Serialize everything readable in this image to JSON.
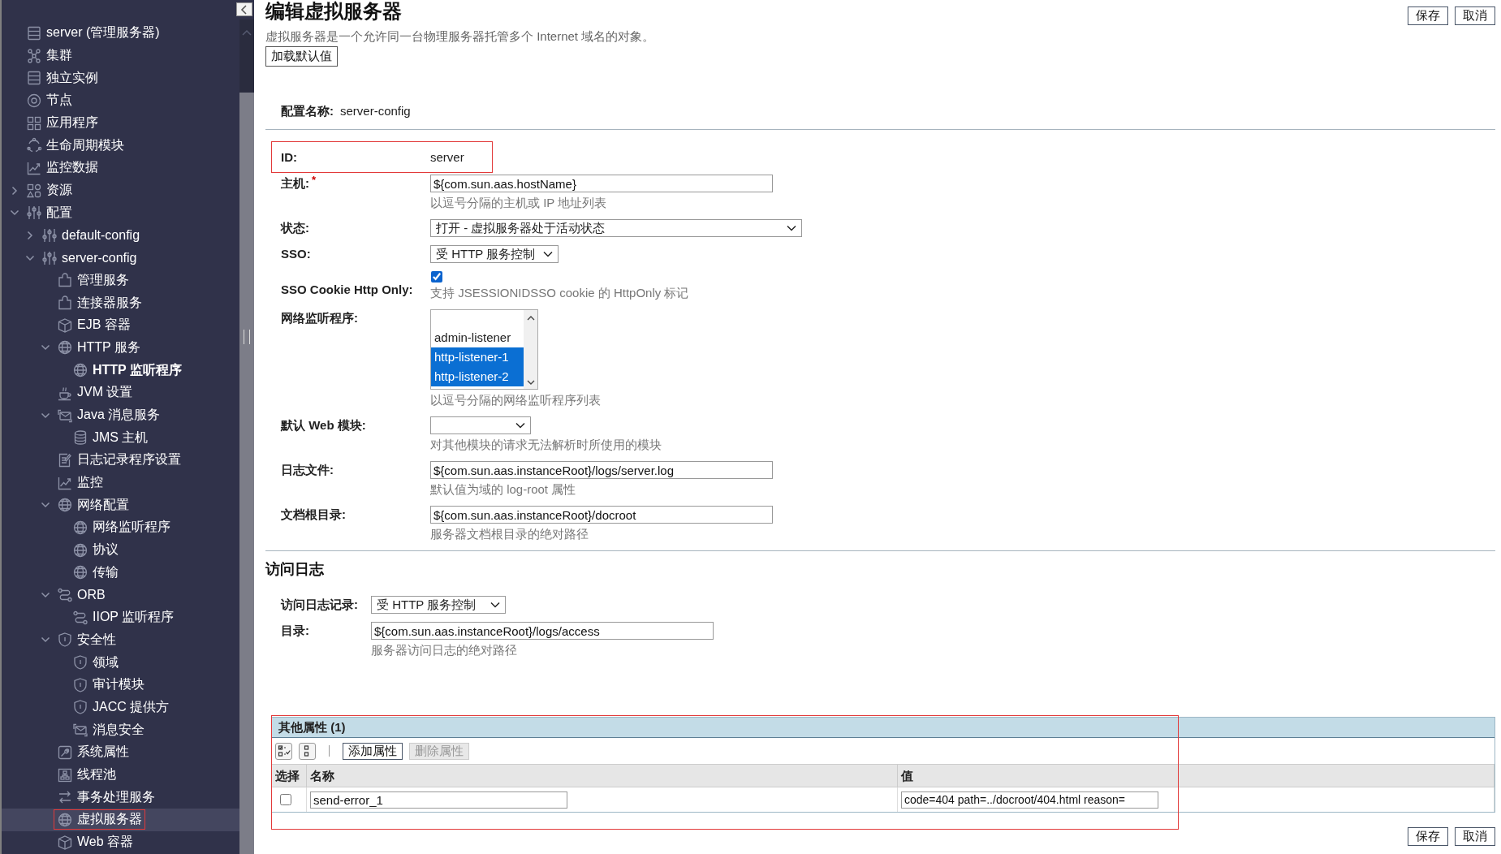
{
  "sidebar": {
    "items": [
      {
        "label": "server (管理服务器)",
        "kind": "server"
      },
      {
        "label": "集群",
        "kind": "cluster"
      },
      {
        "label": "独立实例",
        "kind": "server"
      },
      {
        "label": "节点",
        "kind": "node"
      },
      {
        "label": "应用程序",
        "kind": "apps"
      },
      {
        "label": "生命周期模块",
        "kind": "cycle"
      },
      {
        "label": "监控数据",
        "kind": "chart"
      },
      {
        "label": "资源",
        "kind": "shapes",
        "expanded": false
      },
      {
        "label": "配置",
        "kind": "sliders",
        "expanded": true,
        "children": [
          {
            "label": "default-config",
            "kind": "sliders",
            "expanded": false
          },
          {
            "label": "server-config",
            "kind": "sliders",
            "expanded": true,
            "children": [
              {
                "label": "管理服务",
                "kind": "puzzle"
              },
              {
                "label": "连接器服务",
                "kind": "puzzle"
              },
              {
                "label": "EJB 容器",
                "kind": "cube"
              },
              {
                "label": "HTTP 服务",
                "kind": "globe",
                "expanded": true,
                "children": [
                  {
                    "label": "HTTP 监听程序",
                    "kind": "globe",
                    "bold": true
                  }
                ]
              },
              {
                "label": "JVM 设置",
                "kind": "cup"
              },
              {
                "label": "Java 消息服务",
                "kind": "mail",
                "expanded": true,
                "children": [
                  {
                    "label": "JMS 主机",
                    "kind": "db"
                  }
                ]
              },
              {
                "label": "日志记录程序设置",
                "kind": "doc"
              },
              {
                "label": "监控",
                "kind": "chart"
              },
              {
                "label": "网络配置",
                "kind": "globe",
                "expanded": true,
                "children": [
                  {
                    "label": "网络监听程序",
                    "kind": "globe"
                  },
                  {
                    "label": "协议",
                    "kind": "globe"
                  },
                  {
                    "label": "传输",
                    "kind": "globe"
                  }
                ]
              },
              {
                "label": "ORB",
                "kind": "route",
                "expanded": true,
                "children": [
                  {
                    "label": "IIOP 监听程序",
                    "kind": "route"
                  }
                ]
              },
              {
                "label": "安全性",
                "kind": "shield",
                "expanded": true,
                "children": [
                  {
                    "label": "领域",
                    "kind": "shield"
                  },
                  {
                    "label": "审计模块",
                    "kind": "shield"
                  },
                  {
                    "label": "JACC 提供方",
                    "kind": "shield"
                  },
                  {
                    "label": "消息安全",
                    "kind": "mail"
                  }
                ]
              },
              {
                "label": "系统属性",
                "kind": "wrench"
              },
              {
                "label": "线程池",
                "kind": "pool"
              },
              {
                "label": "事务处理服务",
                "kind": "arrows"
              },
              {
                "label": "虚拟服务器",
                "kind": "globe",
                "selected": true,
                "highlighted": true
              },
              {
                "label": "Web 容器",
                "kind": "cube"
              }
            ]
          }
        ]
      }
    ]
  },
  "page": {
    "title": "编辑虚拟服务器",
    "description": "虚拟服务器是一个允许同一台物理服务器托管多个 Internet 域名的对象。",
    "load_defaults_button": "加载默认值",
    "top_buttons": [
      "保存",
      "取消"
    ],
    "config_name": {
      "label": "配置名称:",
      "value": "server-config"
    }
  },
  "form": {
    "fields": [
      {
        "kind": "text",
        "label": "ID:",
        "value": "server",
        "highlighted": true
      },
      {
        "kind": "input",
        "label": "主机:",
        "required_mark": "*",
        "value": "${com.sun.aas.hostName}",
        "help": "以逗号分隔的主机或 IP 地址列表"
      },
      {
        "kind": "select",
        "label": "状态:",
        "value": "打开 - 虚拟服务器处于活动状态"
      },
      {
        "kind": "select",
        "label": "SSO:",
        "value": "受 HTTP 服务控制"
      },
      {
        "kind": "checkbox",
        "label": "SSO Cookie Http Only:",
        "checked": true,
        "help": "支持 JSESSIONIDSSO cookie 的 HttpOnly 标记"
      },
      {
        "kind": "listbox",
        "label": "网络监听程序:",
        "options": [
          {
            "label": "admin-listener",
            "selected": false
          },
          {
            "label": "http-listener-1",
            "selected": true
          },
          {
            "label": "http-listener-2",
            "selected": true
          }
        ],
        "help": "以逗号分隔的网络监听程序列表"
      },
      {
        "kind": "select",
        "label": "默认 Web 模块:",
        "help": "对其他模块的请求无法解析时所使用的模块"
      },
      {
        "kind": "input",
        "label": "日志文件:",
        "value": "${com.sun.aas.instanceRoot}/logs/server.log",
        "help": "默认值为域的 log-root 属性"
      },
      {
        "kind": "input",
        "label": "文档根目录:",
        "value": "${com.sun.aas.instanceRoot}/docroot",
        "help": "服务器文档根目录的绝对路径"
      }
    ]
  },
  "access_log": {
    "title": "访问日志",
    "fields": [
      {
        "kind": "select",
        "label": "访问日志记录:",
        "value": "受 HTTP 服务控制"
      },
      {
        "kind": "input",
        "label": "目录:",
        "value": "${com.sun.aas.instanceRoot}/logs/access",
        "help": "服务器访问日志的绝对路径"
      }
    ]
  },
  "properties": {
    "title": "其他属性 (1)",
    "highlighted": true,
    "buttons": [
      {
        "label": "添加属性",
        "disabled": false
      },
      {
        "label": "删除属性",
        "disabled": true
      }
    ],
    "columns": [
      "选择",
      "名称",
      "值"
    ],
    "rows": [
      {
        "checked": false,
        "name": "send-error_1",
        "value": "code=404 path=../docroot/404.html reason="
      }
    ]
  },
  "bottom_buttons": [
    "保存",
    "取消"
  ]
}
